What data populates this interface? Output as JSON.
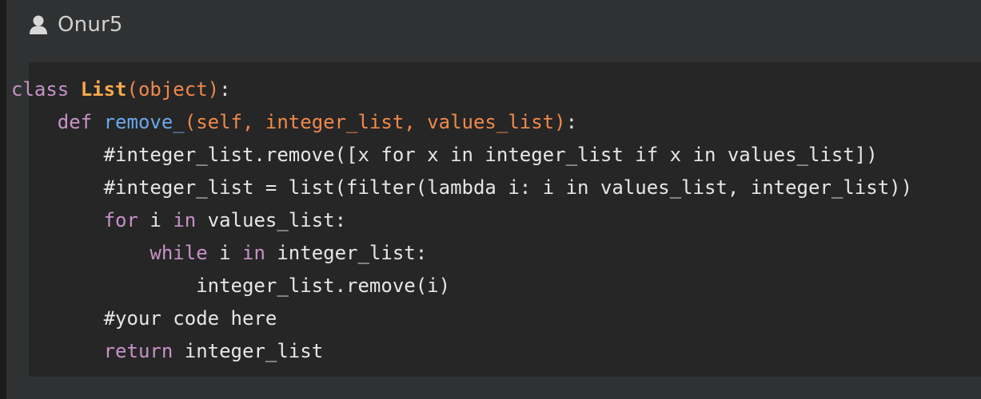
{
  "post": {
    "author": "Onur5",
    "author_icon": "user-icon"
  },
  "code": {
    "lines": [
      [
        {
          "t": "class ",
          "c": "kw"
        },
        {
          "t": "List",
          "c": "cls"
        },
        {
          "t": "(object)",
          "c": "paren"
        },
        {
          "t": ":",
          "c": "plain"
        }
      ],
      [
        {
          "t": "    ",
          "c": "plain"
        },
        {
          "t": "def ",
          "c": "kw"
        },
        {
          "t": "remove_",
          "c": "fn"
        },
        {
          "t": "(self, integer_list, values_list)",
          "c": "param"
        },
        {
          "t": ":",
          "c": "plain"
        }
      ],
      [
        {
          "t": "        #integer_list.remove([x for x in integer_list if x in values_list])",
          "c": "plain"
        }
      ],
      [
        {
          "t": "        #integer_list = list(filter(lambda i: i in values_list, integer_list))",
          "c": "plain"
        }
      ],
      [
        {
          "t": "        ",
          "c": "plain"
        },
        {
          "t": "for",
          "c": "kw"
        },
        {
          "t": " i ",
          "c": "plain"
        },
        {
          "t": "in",
          "c": "kw"
        },
        {
          "t": " values_list:",
          "c": "plain"
        }
      ],
      [
        {
          "t": "            ",
          "c": "plain"
        },
        {
          "t": "while",
          "c": "kw"
        },
        {
          "t": " i ",
          "c": "plain"
        },
        {
          "t": "in",
          "c": "kw"
        },
        {
          "t": " integer_list:",
          "c": "plain"
        }
      ],
      [
        {
          "t": "                integer_list.remove(i)",
          "c": "plain"
        }
      ],
      [
        {
          "t": "        #your code here",
          "c": "plain"
        }
      ],
      [
        {
          "t": "        ",
          "c": "plain"
        },
        {
          "t": "return",
          "c": "kw"
        },
        {
          "t": " integer_list",
          "c": "plain"
        }
      ]
    ]
  },
  "colors": {
    "keyword": "#c792c6",
    "class_name": "#f6a94b",
    "function_name": "#6aa8e8",
    "params": "#f0894a",
    "text": "#e6e6e6",
    "panel_bg": "#303132",
    "code_bg": "#262627"
  }
}
